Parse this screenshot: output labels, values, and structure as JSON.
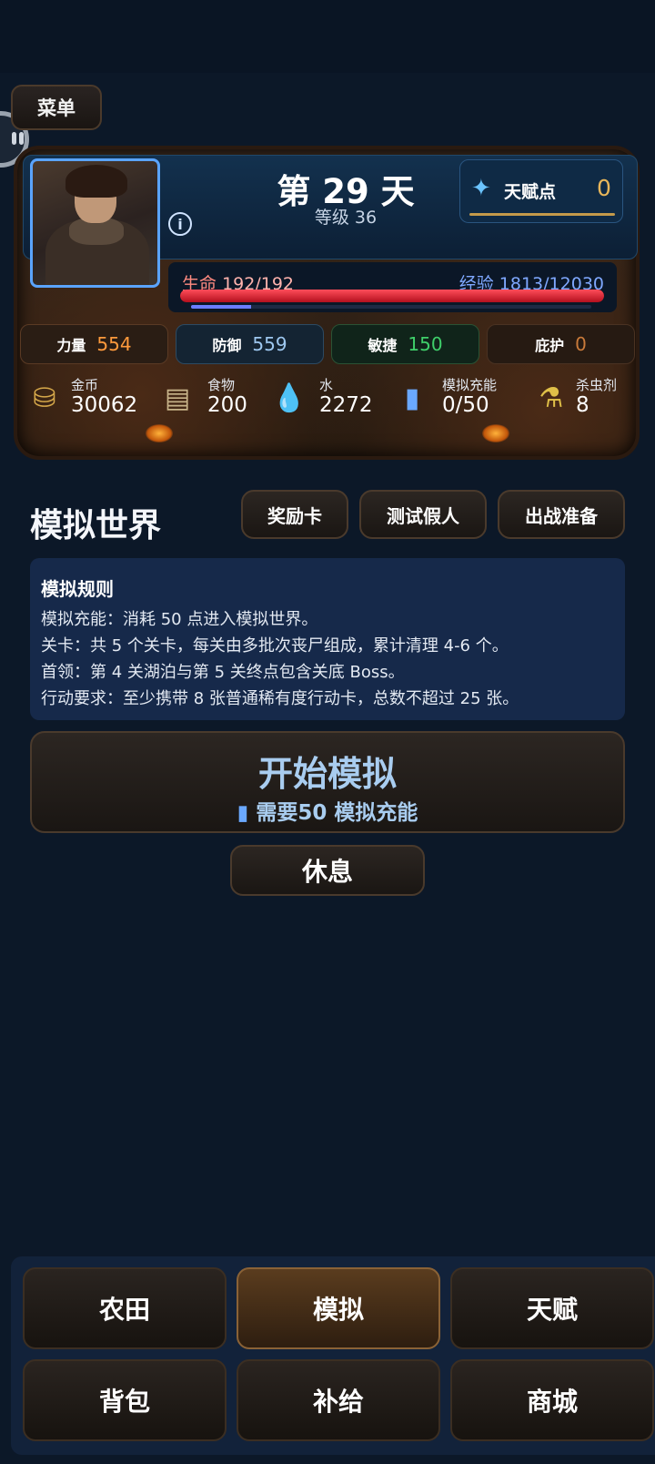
{
  "menu": {
    "label": "菜单"
  },
  "status": {
    "day": "第 29 天",
    "level": "等级 36",
    "talent_label": "天赋点",
    "talent_value": "0",
    "hp_label": "生命",
    "hp_value": "192/192",
    "hp_fraction": 1.0,
    "xp_label": "经验",
    "xp_value": "1813/12030",
    "xp_fraction": 0.15
  },
  "stats": [
    {
      "label": "力量",
      "value": "554"
    },
    {
      "label": "防御",
      "value": "559"
    },
    {
      "label": "敏捷",
      "value": "150"
    },
    {
      "label": "庇护",
      "value": "0"
    }
  ],
  "resources": [
    {
      "label": "金币",
      "value": "30062",
      "icon": "coins-icon"
    },
    {
      "label": "食物",
      "value": "200",
      "icon": "food-icon"
    },
    {
      "label": "水",
      "value": "2272",
      "icon": "water-icon"
    },
    {
      "label": "模拟充能",
      "value": "0/50",
      "icon": "battery-icon"
    },
    {
      "label": "杀虫剂",
      "value": "8",
      "icon": "spray-icon"
    }
  ],
  "section": {
    "title": "模拟世界",
    "buttons": [
      "奖励卡",
      "测试假人",
      "出战准备"
    ]
  },
  "rules": {
    "title": "模拟规则",
    "lines": [
      "模拟充能：消耗 50 点进入模拟世界。",
      "关卡：共 5 个关卡，每关由多批次丧尸组成，累计清理 4-6 个。",
      "首领：第 4 关湖泊与第 5 关终点包含关底 Boss。",
      "行动要求：至少携带 8 张普通稀有度行动卡，总数不超过 25 张。"
    ]
  },
  "start": {
    "title": "开始模拟",
    "subtitle": "需要50 模拟充能"
  },
  "rest": {
    "label": "休息"
  },
  "nav": [
    {
      "label": "农田",
      "active": false
    },
    {
      "label": "模拟",
      "active": true
    },
    {
      "label": "天赋",
      "active": false
    },
    {
      "label": "背包",
      "active": false
    },
    {
      "label": "补给",
      "active": false
    },
    {
      "label": "商城",
      "active": false
    }
  ]
}
